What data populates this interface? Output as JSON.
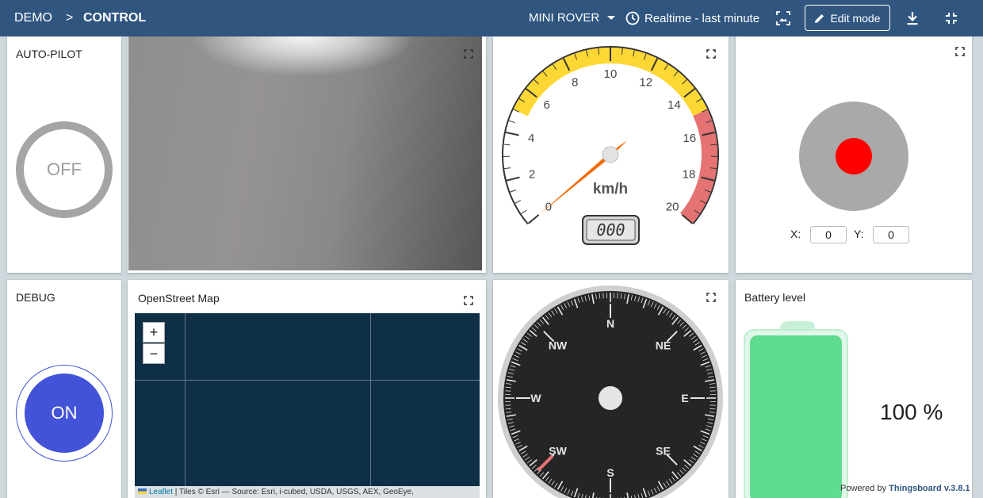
{
  "topbar": {
    "crumb_root": "DEMO",
    "crumb_sep": ">",
    "crumb_current": "CONTROL",
    "device": "MINI ROVER",
    "timewindow": "Realtime - last minute",
    "edit_label": "Edit mode",
    "bg_color": "#305680"
  },
  "autopilot": {
    "title": "AUTO-PILOT",
    "state": "OFF"
  },
  "debug": {
    "title": "DEBUG",
    "state": "ON"
  },
  "speedometer": {
    "unit": "km/h",
    "ticks": [
      "0",
      "2",
      "4",
      "6",
      "8",
      "10",
      "12",
      "14",
      "16",
      "18",
      "20"
    ],
    "value": 0,
    "odometer": "000",
    "min": 0,
    "max": 20,
    "highlights": [
      {
        "from": 5,
        "to": 15,
        "color": "#fdd835"
      },
      {
        "from": 15,
        "to": 20,
        "color": "#e57373"
      }
    ]
  },
  "joystick": {
    "x_label": "X:",
    "x_value": "0",
    "y_label": "Y:",
    "y_value": "0"
  },
  "map": {
    "title": "OpenStreet Map",
    "zoom_in": "+",
    "zoom_out": "−",
    "attrib_link": "Leaflet",
    "attrib_text": " | Tiles © Esri — Source: Esri, i-cubed, USDA, USGS, AEX, GeoEye,"
  },
  "compass": {
    "labels": [
      "N",
      "NE",
      "E",
      "SE",
      "S",
      "SW",
      "W",
      "NW"
    ],
    "heading": 225
  },
  "battery": {
    "title": "Battery level",
    "level": 100,
    "text": "100 %",
    "color": "#5fdc8f"
  },
  "footer": {
    "prefix": "Powered by ",
    "brand": "Thingsboard v.3.8.1"
  }
}
